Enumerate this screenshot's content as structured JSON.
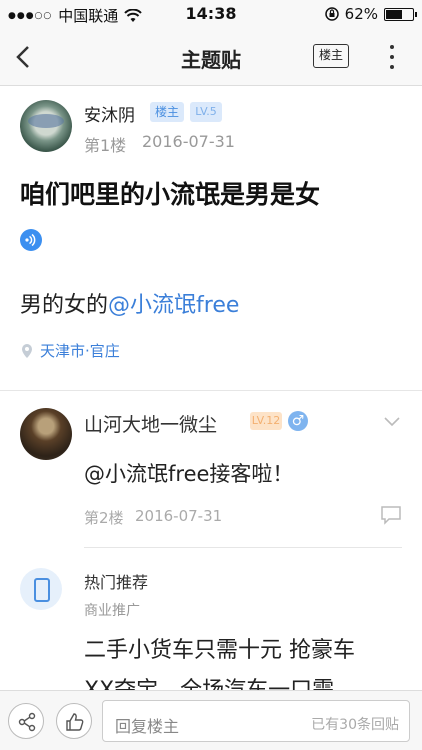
{
  "status_bar": {
    "carrier": "中国联通",
    "time": "14:38",
    "battery": "62%",
    "battery_level": 0.62
  },
  "nav": {
    "title": "主题贴",
    "op_only_label": "楼主"
  },
  "post": {
    "author": "安沐阴",
    "author_badge": "楼主",
    "author_level": "LV.5",
    "floor": "第1楼",
    "date": "2016-07-31",
    "title": "咱们吧里的小流氓是男是女",
    "body_prefix": "男的女的",
    "body_mention": "@小流氓free",
    "location": "天津市·官庄"
  },
  "reply": {
    "author": "山河大地一微尘",
    "level": "LV.12",
    "gender_symbol": "♂",
    "body": "@小流氓free接客啦！",
    "floor": "第2楼",
    "date": "2016-07-31"
  },
  "recommendation": {
    "title": "热门推荐",
    "subtitle": "商业推广",
    "line1": "二手小货车只需十元 抢豪车",
    "line2": "XX夺宝，全场汽车一口需"
  },
  "bottom_bar": {
    "reply_placeholder": "回复楼主",
    "reply_count": "已有30条回贴"
  }
}
